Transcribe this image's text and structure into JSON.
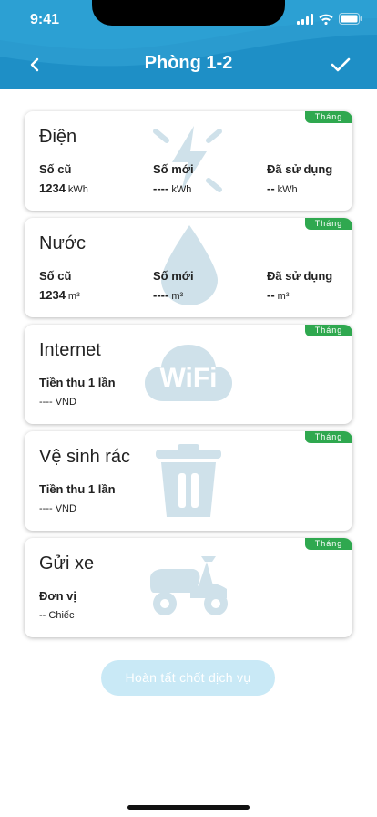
{
  "status_bar": {
    "time": "9:41"
  },
  "header": {
    "title": "Phòng 1-2"
  },
  "cards": [
    {
      "title": "Điện",
      "badge": "Tháng",
      "icon": "lightning-icon",
      "columns": [
        {
          "label": "Số cũ",
          "value": "1234",
          "unit": "kWh"
        },
        {
          "label": "Số mới",
          "value": "----",
          "unit": "kWh"
        },
        {
          "label": "Đã sử dụng",
          "value": "--",
          "unit": "kWh"
        }
      ]
    },
    {
      "title": "Nước",
      "badge": "Tháng",
      "icon": "water-drop-icon",
      "columns": [
        {
          "label": "Số cũ",
          "value": "1234",
          "unit": "m³"
        },
        {
          "label": "Số mới",
          "value": "----",
          "unit": "m³"
        },
        {
          "label": "Đã sử dụng",
          "value": "--",
          "unit": "m³"
        }
      ]
    },
    {
      "title": "Internet",
      "badge": "Tháng",
      "icon": "wifi-icon",
      "icon_text": "WiFi",
      "label": "Tiền thu 1 lần",
      "value": "---- VND"
    },
    {
      "title": "Vệ sinh rác",
      "badge": "Tháng",
      "icon": "trash-icon",
      "label": "Tiền thu 1 lần",
      "value": "---- VND"
    },
    {
      "title": "Gửi xe",
      "badge": "Tháng",
      "icon": "scooter-icon",
      "label": "Đơn vị",
      "value": "-- Chiếc"
    }
  ],
  "submit_button": {
    "label": "Hoàn tất chốt dịch vụ"
  },
  "colors": {
    "header": "#1e8fc6",
    "badge": "#2fa84f",
    "icon_watermark": "#cfe1ea",
    "button_disabled": "#c9e9f6"
  }
}
